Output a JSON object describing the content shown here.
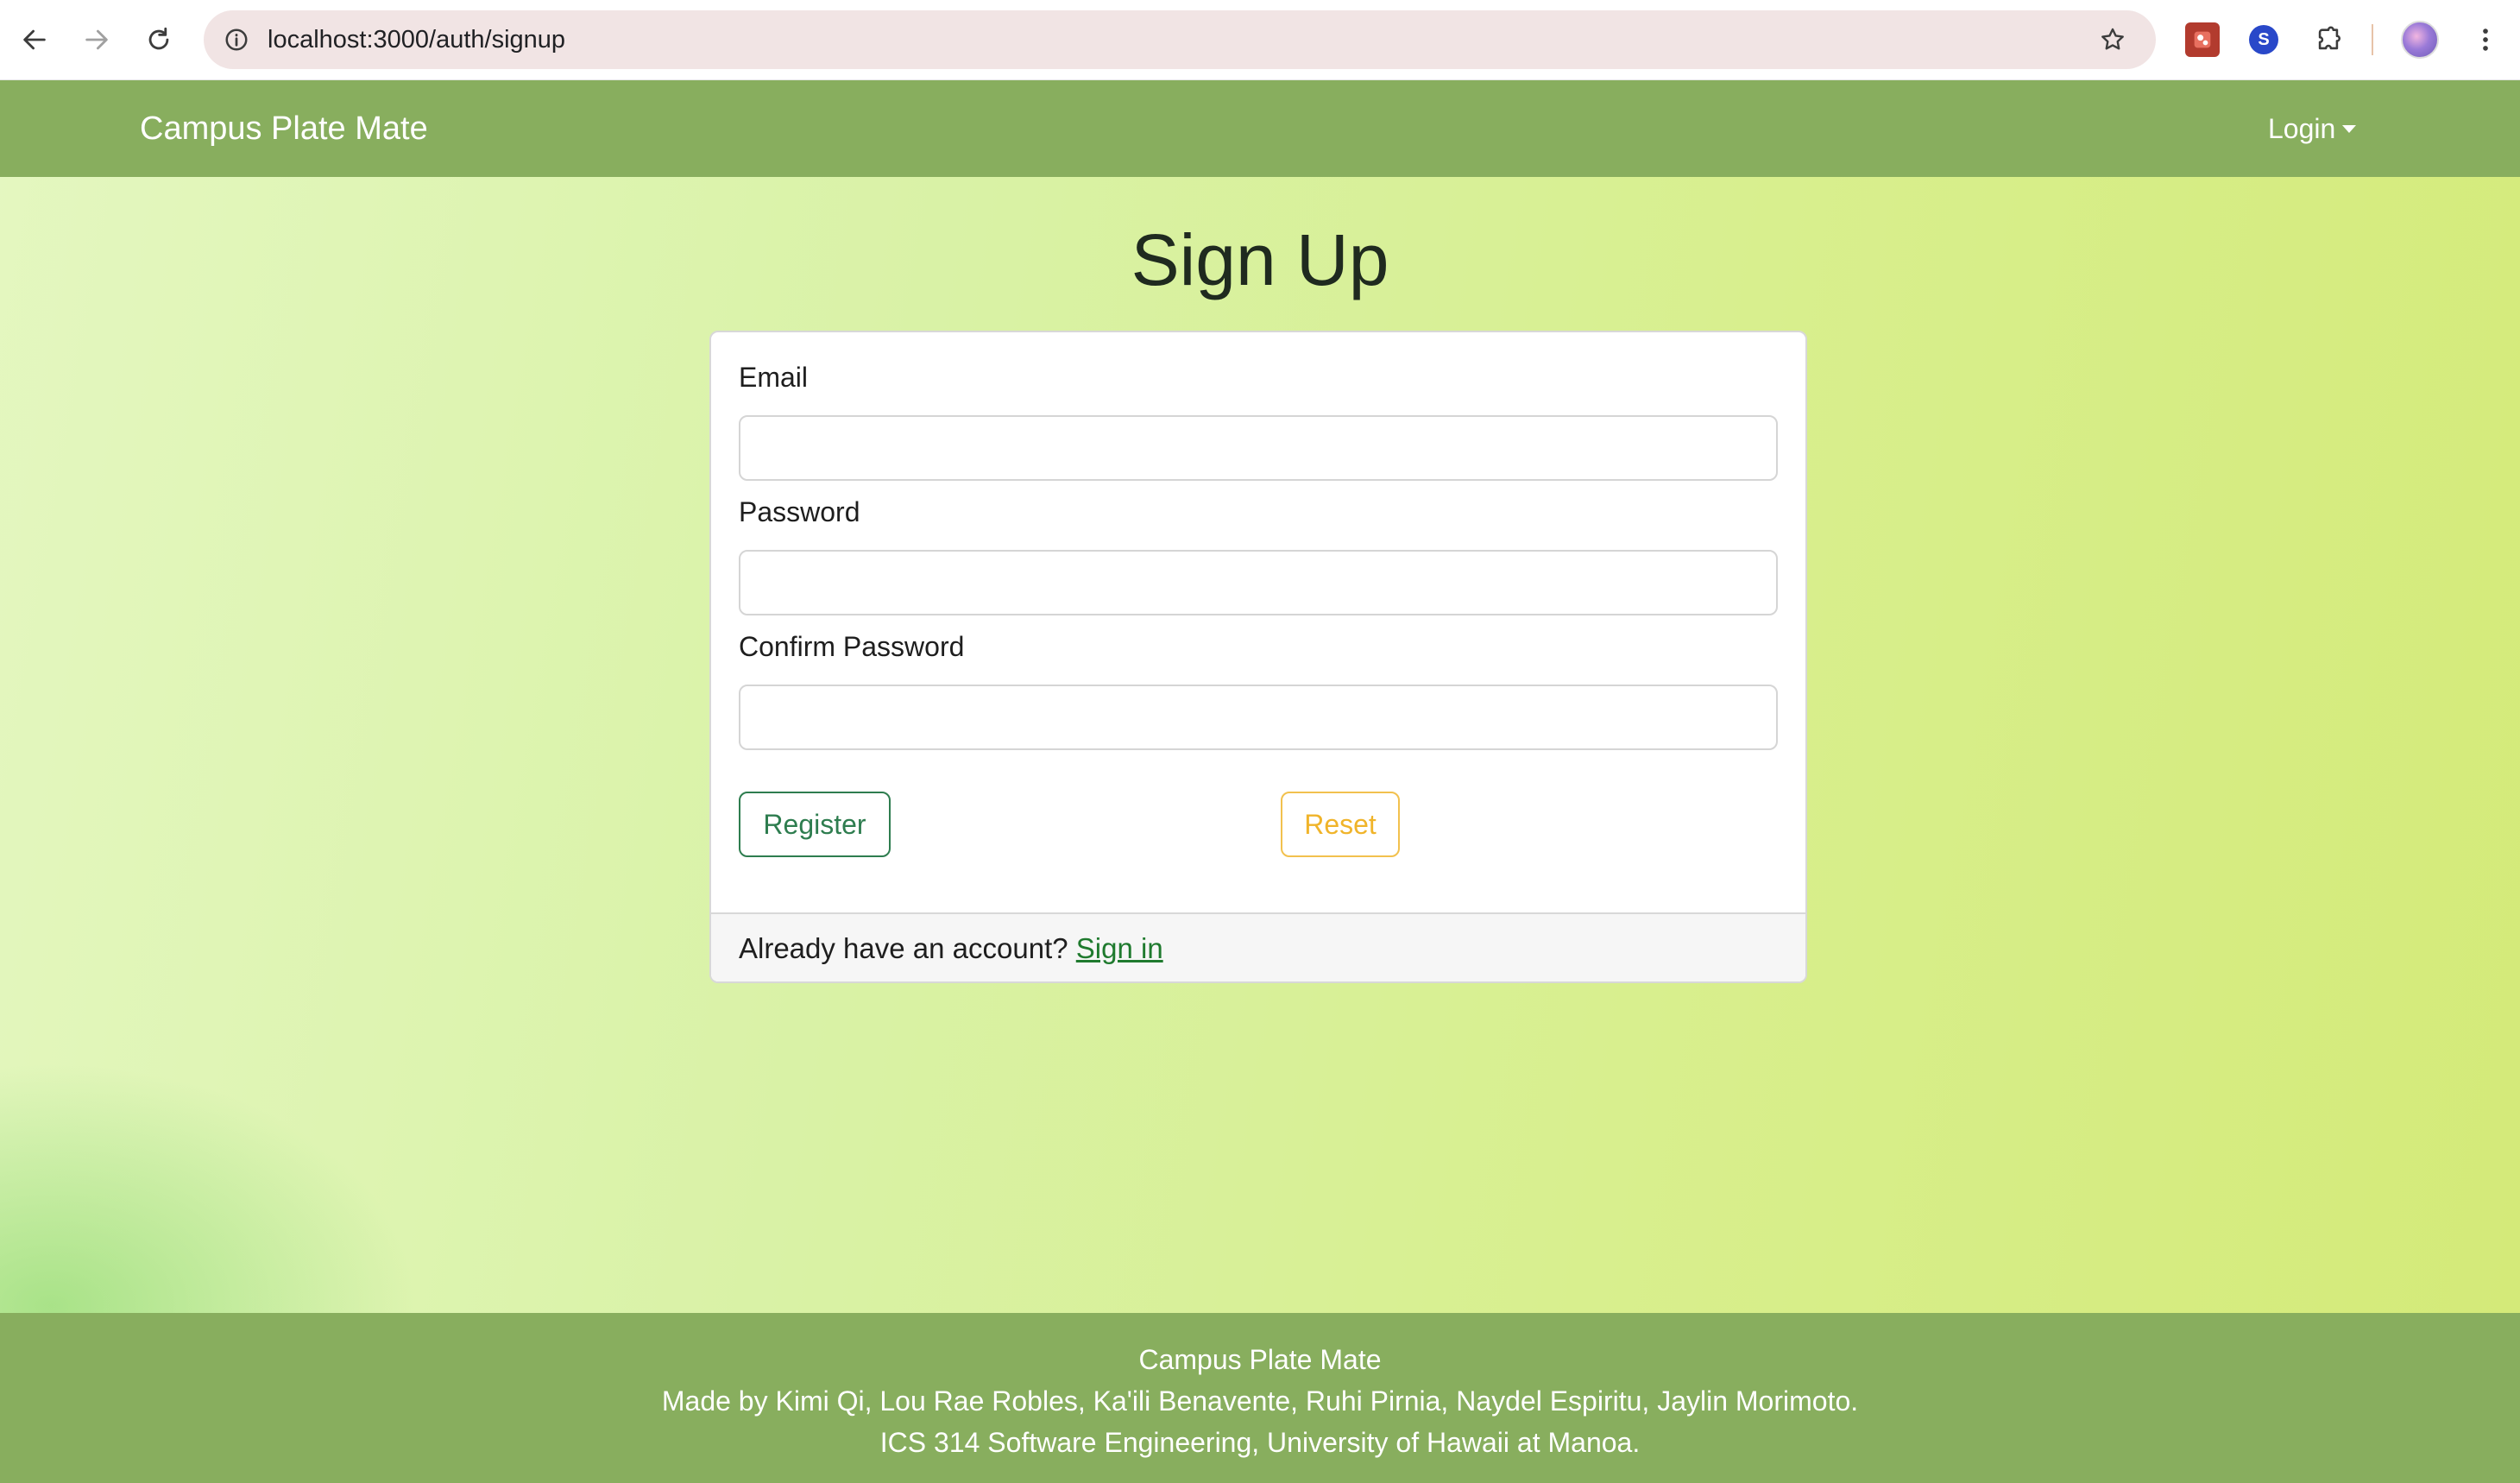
{
  "browser": {
    "url": "localhost:3000/auth/signup"
  },
  "navbar": {
    "brand": "Campus Plate Mate",
    "login_label": "Login"
  },
  "page": {
    "title": "Sign Up"
  },
  "form": {
    "email_label": "Email",
    "email_value": "",
    "password_label": "Password",
    "password_value": "",
    "confirm_label": "Confirm Password",
    "confirm_value": "",
    "register_label": "Register",
    "reset_label": "Reset",
    "footer_text": "Already have an account?",
    "signin_label": "Sign in"
  },
  "footer": {
    "line1": "Campus Plate Mate",
    "line2": "Made by Kimi Qi, Lou Rae Robles, Ka'ili Benavente, Ruhi Pirnia, Naydel Espiritu, Jaylin Morimoto.",
    "line3": "ICS 314 Software Engineering, University of Hawaii at Manoa."
  },
  "colors": {
    "navbar_bg": "#88ae5e",
    "register_border": "#2e7d4f",
    "reset_border": "#f2c14e",
    "link": "#1f7a2e"
  }
}
